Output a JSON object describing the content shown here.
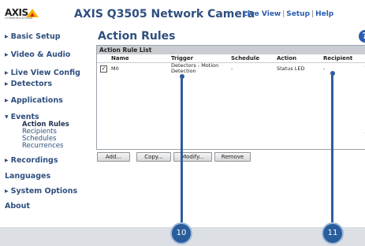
{
  "header": {
    "logo_text": "AXIS",
    "logo_subtext": "COMMUNICATIONS",
    "camera_title": "AXIS Q3505 Network Camera",
    "links": [
      "Live View",
      "Setup",
      "Help"
    ]
  },
  "sidebar": {
    "items": [
      {
        "label": "Basic Setup"
      },
      {
        "label": "Video & Audio"
      },
      {
        "label": "Live View Config"
      },
      {
        "label": "Detectors"
      },
      {
        "label": "Applications"
      },
      {
        "label": "Events"
      },
      {
        "label": "Recordings"
      },
      {
        "label": "Languages"
      },
      {
        "label": "System Options"
      },
      {
        "label": "About"
      }
    ],
    "events_sub": [
      "Action Rules",
      "Recipients",
      "Schedules",
      "Recurrences"
    ]
  },
  "main": {
    "title": "Action Rules",
    "panel_title": "Action Rule List",
    "columns": [
      "Name",
      "Trigger",
      "Schedule",
      "Action",
      "Recipient"
    ],
    "rows": [
      {
        "checked": true,
        "name": "M0",
        "trigger_line1": "Detectors - Motion",
        "trigger_line2": "Detection",
        "schedule": "-",
        "action": "Status LED",
        "recipient": "-"
      }
    ],
    "buttons": [
      "Add...",
      "Copy...",
      "Modify...",
      "Remove"
    ]
  },
  "callouts": [
    "10",
    "11"
  ],
  "colors": {
    "brand_blue": "#2f4f7f",
    "link_blue": "#2a5db0",
    "callout_blue": "#2a5d9c",
    "logo_yellow": "#f5b800",
    "logo_red": "#d9261c"
  },
  "icons": {
    "help": "question-mark-circle",
    "nav_arrow": "triangle-right",
    "nav_arrow_open": "triangle-down"
  }
}
